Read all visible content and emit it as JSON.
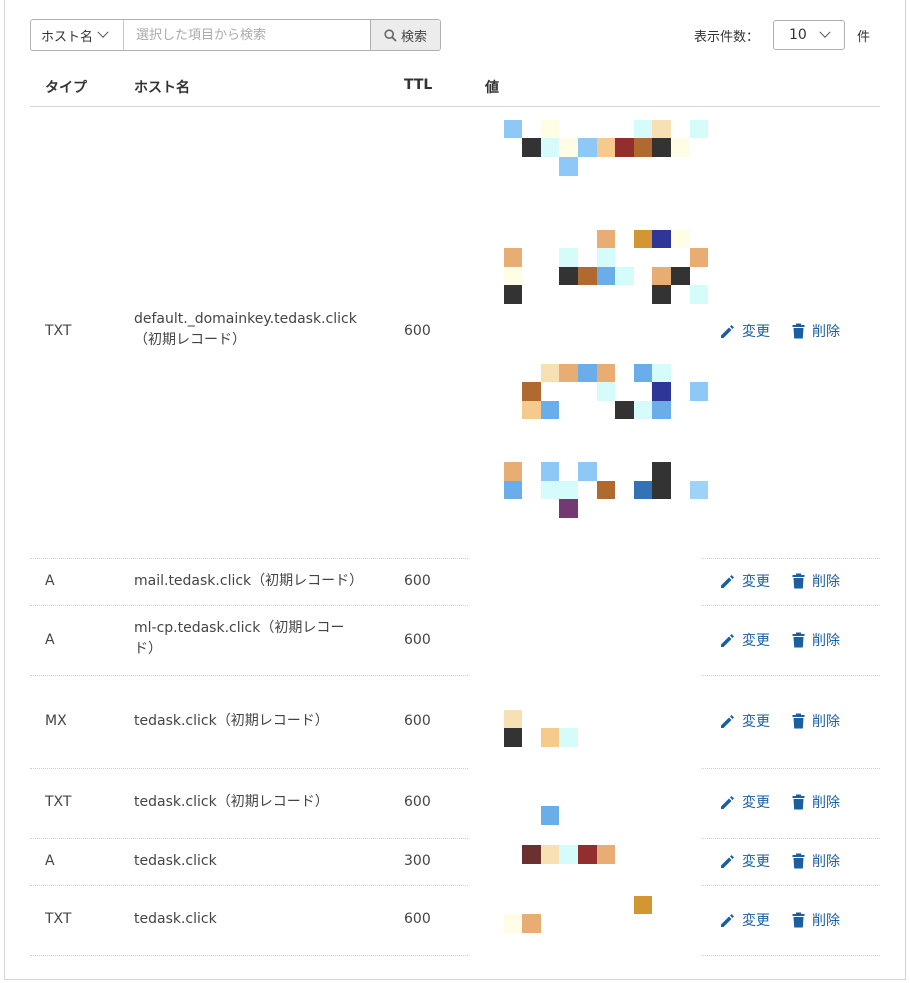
{
  "search": {
    "field_label": "ホスト名",
    "placeholder": "選択した項目から検索",
    "button_label": "検索"
  },
  "pagination": {
    "label": "表示件数：",
    "page_size": "10",
    "unit": "件"
  },
  "table": {
    "headers": [
      "タイプ",
      "ホスト名",
      "TTL",
      "値"
    ],
    "edit_label": "変更",
    "delete_label": "削除",
    "rows": [
      {
        "type": "TXT",
        "host": "default._domainkey.tedask.click（初期レコード）",
        "ttl": "600"
      },
      {
        "type": "A",
        "host": "mail.tedask.click（初期レコード）",
        "ttl": "600"
      },
      {
        "type": "A",
        "host": "ml-cp.tedask.click（初期レコード）",
        "ttl": "600"
      },
      {
        "type": "MX",
        "host": "tedask.click（初期レコード）",
        "ttl": "600"
      },
      {
        "type": "TXT",
        "host": "tedask.click（初期レコード）",
        "ttl": "600"
      },
      {
        "type": "A",
        "host": "tedask.click",
        "ttl": "300"
      },
      {
        "type": "TXT",
        "host": "tedask.click",
        "ttl": "600"
      }
    ]
  },
  "colors": {
    "link": "#1a5fa0",
    "border": "#d4d4d4",
    "mosaic_palette": [
      "#8ec8f7",
      "#fffde6",
      "#d6fbfb",
      "#f7e1b4",
      "#333333",
      "#f6c98c",
      "#932e2e",
      "#b06a30",
      "#6aade8",
      "#e8ad72",
      "#d39633",
      "#2e3797",
      "#3273b6",
      "#723973",
      "#6b3030",
      "#9ed3f7"
    ]
  }
}
